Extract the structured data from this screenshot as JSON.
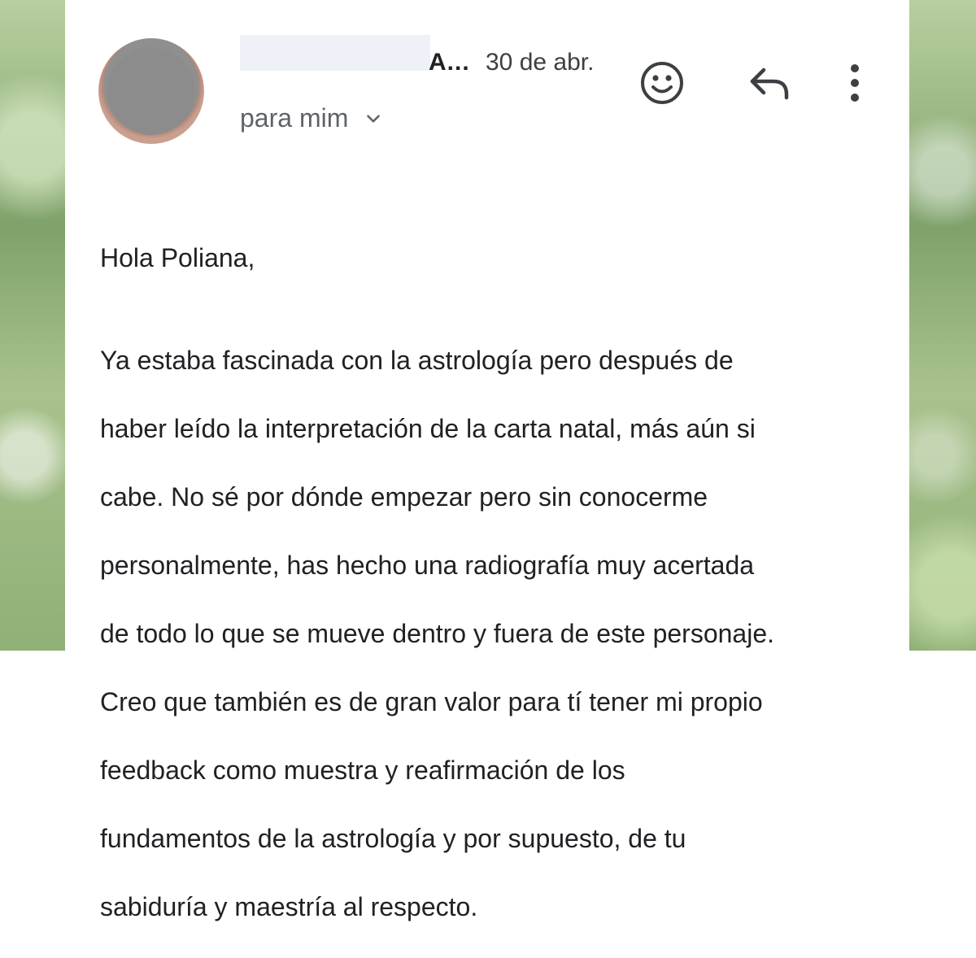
{
  "email": {
    "sender_visible": "A...",
    "date": "30 de abr.",
    "recipient_label": "para mim",
    "icons": {
      "avatar": "avatar",
      "emoji": "emoji-smile-icon",
      "reply": "reply-arrow-icon",
      "more": "more-vert-icon",
      "expand": "chevron-down-icon"
    },
    "greeting": "Hola Poliana,",
    "lines": [
      "Ya estaba fascinada con la astrología pero después de",
      "haber leído la interpretación de la carta natal, más aún si",
      "cabe. No sé por dónde empezar pero sin conocerme",
      "personalmente, has hecho una radiografía muy acertada",
      "de todo lo que se mueve dentro y fuera de este personaje.",
      "Creo que también es de gran valor para tí tener mi propio",
      "feedback como muestra y reafirmación de los",
      "fundamentos de la astrología y por supuesto, de tu",
      "sabiduría y maestría al respecto."
    ]
  },
  "colors": {
    "text": "#202124",
    "secondary_text": "#5f6368",
    "icon": "#3c4043",
    "card_background": "#ffffff"
  }
}
